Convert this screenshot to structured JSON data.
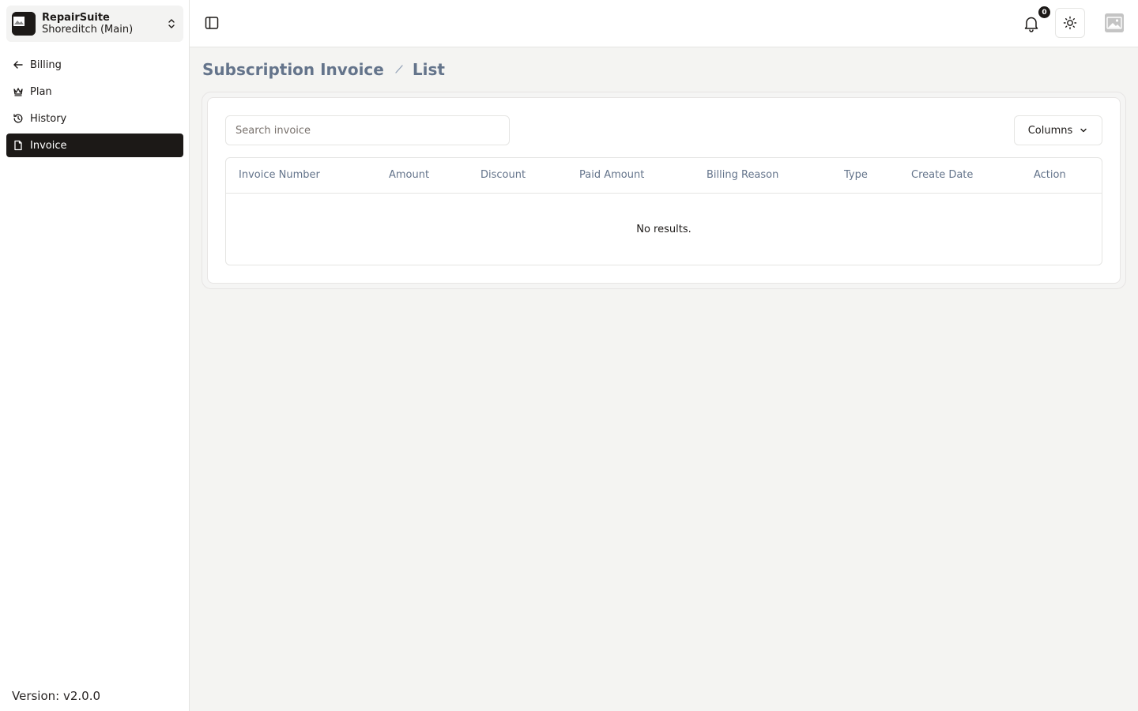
{
  "org": {
    "name": "RepairSuite",
    "branch": "Shoreditch (Main)",
    "logo_icon": "image-placeholder-icon",
    "switch_icon": "chevron-up-down-icon"
  },
  "sidebar": {
    "items": [
      {
        "label": "Billing",
        "icon": "arrow-left-icon",
        "active": false
      },
      {
        "label": "Plan",
        "icon": "crown-icon",
        "active": false
      },
      {
        "label": "History",
        "icon": "history-icon",
        "active": false
      },
      {
        "label": "Invoice",
        "icon": "file-icon",
        "active": true
      }
    ],
    "version": "Version: v2.0.0"
  },
  "header": {
    "notification_count": "0",
    "icons": [
      "sidebar-toggle-icon",
      "bell-icon",
      "sun-icon",
      "avatar-image-icon"
    ]
  },
  "breadcrumb": {
    "section": "Subscription Invoice",
    "page": "List"
  },
  "search": {
    "placeholder": "Search invoice",
    "value": ""
  },
  "toolbar": {
    "columns_label": "Columns"
  },
  "table": {
    "columns": [
      "Invoice Number",
      "Amount",
      "Discount",
      "Paid Amount",
      "Billing Reason",
      "Type",
      "Create Date",
      "Action"
    ],
    "rows": [],
    "empty_text": "No results."
  },
  "colors": {
    "accent": "#1c1917",
    "muted_text": "#64748b",
    "background": "#f4f4f2"
  }
}
